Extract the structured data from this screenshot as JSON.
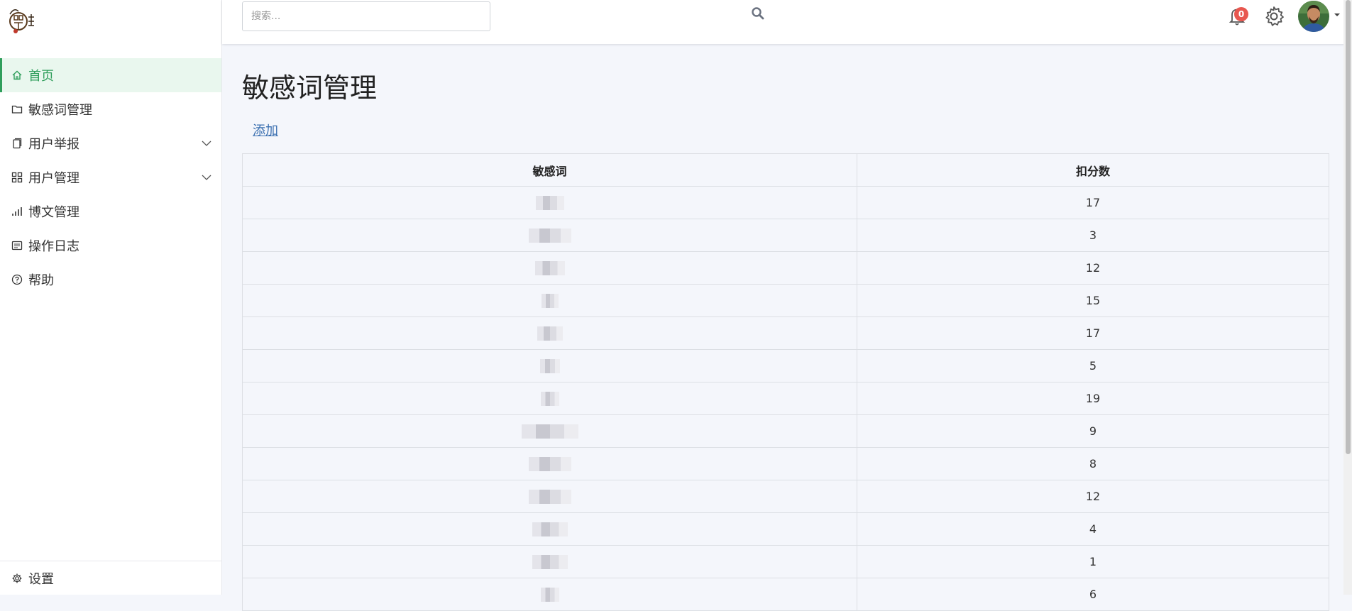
{
  "sidebar": {
    "logo_icon": "seal-logo",
    "items": [
      {
        "label": "首页",
        "icon": "home-icon",
        "active": true,
        "has_children": false
      },
      {
        "label": "敏感词管理",
        "icon": "folder-icon",
        "active": false,
        "has_children": false
      },
      {
        "label": "用户举报",
        "icon": "copy-icon",
        "active": false,
        "has_children": true
      },
      {
        "label": "用户管理",
        "icon": "grid-icon",
        "active": false,
        "has_children": true
      },
      {
        "label": "博文管理",
        "icon": "bar-chart-icon",
        "active": false,
        "has_children": false
      },
      {
        "label": "操作日志",
        "icon": "list-icon",
        "active": false,
        "has_children": false
      },
      {
        "label": "帮助",
        "icon": "help-circle-icon",
        "active": false,
        "has_children": false
      }
    ],
    "settings_label": "设置"
  },
  "header": {
    "search_placeholder": "搜索...",
    "notification_count": "0"
  },
  "main": {
    "title": "敏感词管理",
    "add_label": "添加",
    "table": {
      "columns": [
        "敏感词",
        "扣分数"
      ],
      "rows": [
        {
          "word": "",
          "score": "17"
        },
        {
          "word": "",
          "score": "3"
        },
        {
          "word": "",
          "score": "12"
        },
        {
          "word": "",
          "score": "15"
        },
        {
          "word": "",
          "score": "17"
        },
        {
          "word": "",
          "score": "5"
        },
        {
          "word": "",
          "score": "19"
        },
        {
          "word": "",
          "score": "9"
        },
        {
          "word": "",
          "score": "8"
        },
        {
          "word": "",
          "score": "12"
        },
        {
          "word": "",
          "score": "4"
        },
        {
          "word": "",
          "score": "1"
        },
        {
          "word": "",
          "score": "6"
        }
      ]
    }
  },
  "colors": {
    "accent": "#2f9e5b",
    "active_bg": "#e9f7ee",
    "link": "#3a6fb0",
    "badge": "#e8574f",
    "page_bg": "#f4f6fb"
  }
}
